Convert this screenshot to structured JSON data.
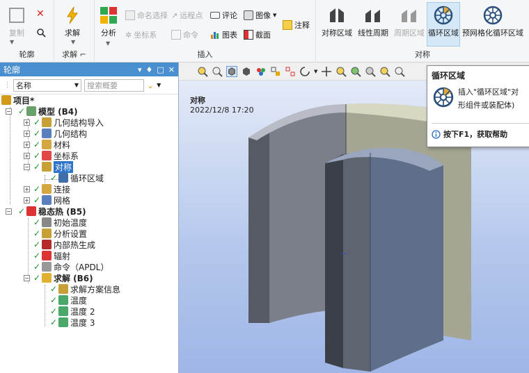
{
  "ribbon": {
    "outline": {
      "copy": "复制",
      "group": "轮廓"
    },
    "solve": {
      "label": "求解",
      "group": "求解"
    },
    "analysis": {
      "label": "分析"
    },
    "insert": {
      "named_selection": "命名选择",
      "remote_point": "远程点",
      "comment": "评论",
      "image": "图像",
      "coord_system": "坐标系",
      "command": "命令",
      "chart": "图表",
      "section": "截面",
      "annotation": "注释",
      "group": "插入"
    },
    "symmetry": {
      "symmetric_region": "对称区域",
      "linear_periodic": "线性周期",
      "periodic_region": "周期区域",
      "cyclic_region": "循环区域",
      "premesh_cyclic": "预网格化循环区域",
      "group": "对称"
    }
  },
  "panel": {
    "title": "轮廓",
    "controls": [
      "▾",
      "♦",
      "□",
      "✕"
    ],
    "filter_select": "名称",
    "search_placeholder": "搜索概要"
  },
  "tree": [
    {
      "label": "项目*",
      "bold": true
    },
    {
      "label": "模型 (B4)",
      "bold": true
    },
    {
      "label": "几何结构导入"
    },
    {
      "label": "几何结构"
    },
    {
      "label": "材料"
    },
    {
      "label": "坐标系"
    },
    {
      "label": "对称",
      "selected": true
    },
    {
      "label": "循环区域"
    },
    {
      "label": "连接"
    },
    {
      "label": "网格"
    },
    {
      "label": "稳态热 (B5)",
      "bold": true
    },
    {
      "label": "初始温度"
    },
    {
      "label": "分析设置"
    },
    {
      "label": "内部热生成"
    },
    {
      "label": "辐射"
    },
    {
      "label": "命令（APDL）"
    },
    {
      "label": "求解 (B6)",
      "bold": true
    },
    {
      "label": "求解方案信息"
    },
    {
      "label": "温度"
    },
    {
      "label": "温度 2"
    },
    {
      "label": "温度 3"
    }
  ],
  "viewport": {
    "title": "对称",
    "date": "2022/12/8 17:20"
  },
  "tooltip": {
    "title": "循环区域",
    "line1": "插入\"循环区域\"对",
    "line2": "形组件或装配体)",
    "help": "按下F1，获取帮助"
  },
  "colors": {
    "accent": "#4a8fd0",
    "selection": "#2e74c9",
    "check": "#1e9a2e"
  }
}
